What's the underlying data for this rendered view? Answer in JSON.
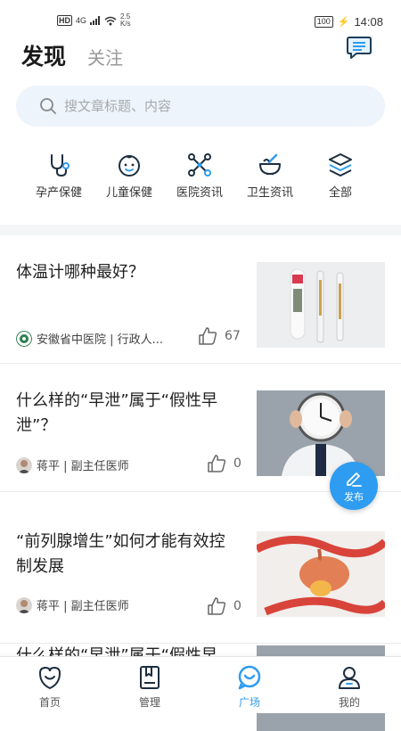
{
  "status_bar": {
    "hd": "HD",
    "network": "4G",
    "speed_value": "2.5",
    "speed_unit": "K/s",
    "battery": "100",
    "time": "14:08"
  },
  "header": {
    "tab_active": "发现",
    "tab_inactive": "关注"
  },
  "search": {
    "placeholder": "搜文章标题、内容"
  },
  "categories": [
    {
      "label": "孕产保健",
      "icon": "stethoscope-icon"
    },
    {
      "label": "儿童保健",
      "icon": "baby-face-icon"
    },
    {
      "label": "医院资讯",
      "icon": "network-icon"
    },
    {
      "label": "卫生资讯",
      "icon": "mortar-bowl-icon"
    },
    {
      "label": "全部",
      "icon": "layers-icon"
    }
  ],
  "articles": [
    {
      "title": "体温计哪种最好？",
      "author": "安徽省中医院 | 行政人...",
      "likes": "67"
    },
    {
      "title": "什么样的“早泄”属于“假性早泄”？",
      "author": "蒋平 | 副主任医师",
      "likes": "0"
    },
    {
      "title": "“前列腺增生”如何才能有效控制发展",
      "author": "蒋平 | 副主任医师",
      "likes": "0"
    },
    {
      "title": "什么样的“早泄”属于“假性早",
      "author": "",
      "likes": ""
    }
  ],
  "fab": {
    "label": "发布"
  },
  "bottom_nav": [
    {
      "label": "首页",
      "icon": "home-smile-icon"
    },
    {
      "label": "管理",
      "icon": "bookmark-book-icon"
    },
    {
      "label": "广场",
      "icon": "plaza-chat-icon"
    },
    {
      "label": "我的",
      "icon": "user-icon"
    }
  ],
  "colors": {
    "accent": "#2e9cf0",
    "search_bg": "#edf4fb",
    "divider": "#f4f5f7"
  }
}
